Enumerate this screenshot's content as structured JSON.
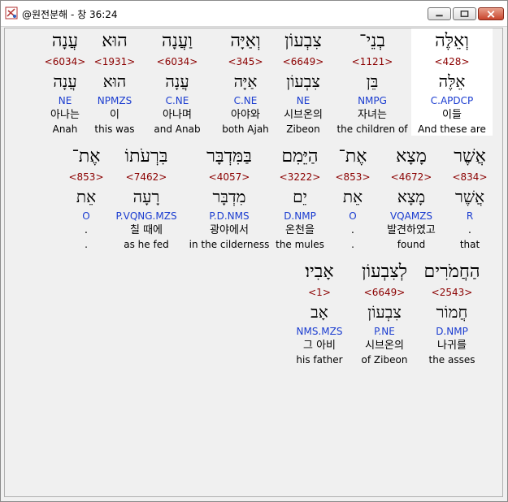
{
  "window": {
    "title": "@원전분해 - 창 36:24",
    "icon": "bible-app-icon",
    "buttons": [
      "minimize-icon",
      "maximize-icon",
      "close-icon"
    ]
  },
  "rows": [
    {
      "words": [
        {
          "hebrew": "וְאֵלֶּה",
          "strong": "<428>",
          "lemma": "אֵלֶּה",
          "morph": "C.APDCP",
          "korean": "이들",
          "english": "And these are",
          "highlighted": true
        },
        {
          "hebrew": "בְנֵי־",
          "strong": "<1121>",
          "lemma": "בֵּן",
          "morph": "NMPG",
          "korean": "자녀는",
          "english": "the children of"
        },
        {
          "hebrew": "צִבְעוֹן",
          "strong": "<6649>",
          "lemma": "צִבְעוֹן",
          "morph": "NE",
          "korean": "시브온의",
          "english": "Zibeon"
        },
        {
          "hebrew": "וְאַיָּה",
          "strong": "<345>",
          "lemma": "אַיָּה",
          "morph": "C.NE",
          "korean": "아야와",
          "english": "both Ajah"
        },
        {
          "hebrew": "וַעֲנָה",
          "strong": "<6034>",
          "lemma": "עֲנָה",
          "morph": "C.NE",
          "korean": "아나며",
          "english": "and Anab"
        },
        {
          "hebrew": "הוּא",
          "strong": "<1931>",
          "lemma": "הוּא",
          "morph": "NPMZS",
          "korean": "이",
          "english": "this was"
        },
        {
          "hebrew": "עֲנָה",
          "strong": "<6034>",
          "lemma": "עֲנָה",
          "morph": "NE",
          "korean": "아나는",
          "english": "Anah"
        }
      ]
    },
    {
      "words": [
        {
          "hebrew": "אֲשֶׁר",
          "strong": "<834>",
          "lemma": "אֲשֶׁר",
          "morph": "R",
          "korean": ".",
          "english": "that"
        },
        {
          "hebrew": "מָצָא",
          "strong": "<4672>",
          "lemma": "מָצָא",
          "morph": "VQAMZS",
          "korean": "발견하였고",
          "english": "found"
        },
        {
          "hebrew": "אֶת־",
          "strong": "<853>",
          "lemma": "אֵת",
          "morph": "O",
          "korean": ".",
          "english": "."
        },
        {
          "hebrew": "הַיֵּמִם",
          "strong": "<3222>",
          "lemma": "יֵם",
          "morph": "D.NMP",
          "korean": "온천을",
          "english": "the mules"
        },
        {
          "hebrew": "בַּמִּדְבָּר",
          "strong": "<4057>",
          "lemma": "מִדְבָּר",
          "morph": "P.D.NMS",
          "korean": "광야에서",
          "english": "in the cilderness"
        },
        {
          "hebrew": "בִּרְעֹתוֹ",
          "strong": "<7462>",
          "lemma": "רָעָה",
          "morph": "P.VQNG.MZS",
          "korean": "칠 때에",
          "english": "as he fed"
        },
        {
          "hebrew": "אֶת־",
          "strong": "<853>",
          "lemma": "אֵת",
          "morph": "O",
          "korean": ".",
          "english": "."
        }
      ]
    },
    {
      "words": [
        {
          "hebrew": "הַחֲמֹרִים",
          "strong": "<2543>",
          "lemma": "חֲמוֹר",
          "morph": "D.NMP",
          "korean": "나귀를",
          "english": "the asses"
        },
        {
          "hebrew": "לְצִבְעוֹן",
          "strong": "<6649>",
          "lemma": "צִבְעוֹן",
          "morph": "P.NE",
          "korean": "시브온의",
          "english": "of Zibeon"
        },
        {
          "hebrew": "אָבִיו׃",
          "strong": "<1>",
          "lemma": "אָב",
          "morph": "NMS.MZS",
          "korean": "그 아비",
          "english": "his father"
        }
      ]
    }
  ]
}
